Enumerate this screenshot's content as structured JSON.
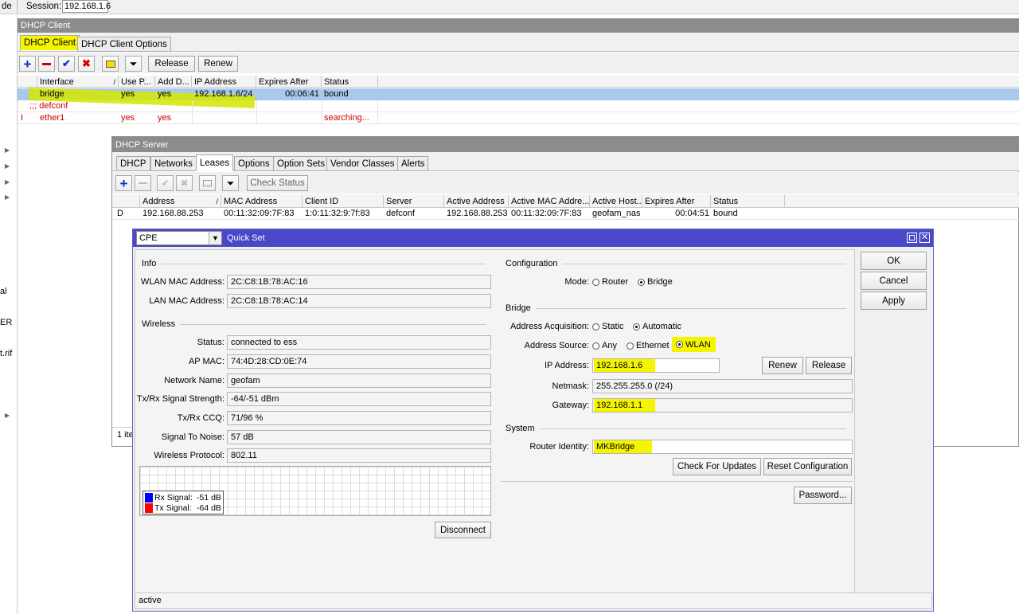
{
  "topbar": {
    "cut_left": "de",
    "session_label": "Session:",
    "session_value": "192.168.1.6"
  },
  "left_strip": {
    "labels": [
      "al",
      "ER",
      "t.rif"
    ]
  },
  "dhcp_client": {
    "title": "DHCP Client",
    "tabs": [
      "DHCP Client",
      "DHCP Client Options"
    ],
    "toolbar": {
      "release": "Release",
      "renew": "Renew"
    },
    "columns": [
      "Interface",
      "Use P...",
      "Add D...",
      "IP Address",
      "Expires After",
      "Status"
    ],
    "rows": [
      {
        "flag": "",
        "interface": "bridge",
        "use_peer": "yes",
        "add_default": "yes",
        "ip": "192.168.1.6/24",
        "expires": "00:06:41",
        "status": "bound"
      },
      {
        "flag": "",
        "interface": ";;; defconf",
        "use_peer": "",
        "add_default": "",
        "ip": "",
        "expires": "",
        "status": ""
      },
      {
        "flag": "I",
        "interface": "ether1",
        "use_peer": "yes",
        "add_default": "yes",
        "ip": "",
        "expires": "",
        "status": "searching..."
      }
    ]
  },
  "dhcp_server": {
    "title": "DHCP Server",
    "tabs": [
      "DHCP",
      "Networks",
      "Leases",
      "Options",
      "Option Sets",
      "Vendor Classes",
      "Alerts"
    ],
    "toolbar": {
      "check_status": "Check Status"
    },
    "columns": [
      "Address",
      "MAC Address",
      "Client ID",
      "Server",
      "Active Address",
      "Active MAC Addre...",
      "Active Host...",
      "Expires After",
      "Status"
    ],
    "rows": [
      {
        "flag": "D",
        "address": "192.168.88.253",
        "mac": "00:11:32:09:7F:83",
        "client_id": "1:0:11:32:9:7f:83",
        "server": "defconf",
        "active_address": "192.168.88.253",
        "active_mac": "00:11:32:09:7F:83",
        "active_host": "geofam_nas",
        "expires": "00:04:51",
        "status": "bound"
      }
    ],
    "footer": "1 ite"
  },
  "quick_set": {
    "mode_select": "CPE",
    "title": "Quick Set",
    "info": {
      "heading": "Info",
      "wlan_mac_label": "WLAN MAC Address:",
      "wlan_mac": "2C:C8:1B:78:AC:16",
      "lan_mac_label": "LAN MAC Address:",
      "lan_mac": "2C:C8:1B:78:AC:14"
    },
    "wireless": {
      "heading": "Wireless",
      "status_label": "Status:",
      "status": "connected to ess",
      "ap_mac_label": "AP MAC:",
      "ap_mac": "74:4D:28:CD:0E:74",
      "network_name_label": "Network Name:",
      "network_name": "geofam",
      "signal_label": "Tx/Rx Signal Strength:",
      "signal": "-64/-51 dBm",
      "ccq_label": "Tx/Rx CCQ:",
      "ccq": "71/96 %",
      "snr_label": "Signal To Noise:",
      "snr": "57 dB",
      "protocol_label": "Wireless Protocol:",
      "protocol": "802.11",
      "legend_rx_label": "Rx Signal:",
      "legend_rx": "-51 dB",
      "legend_tx_label": "Tx Signal:",
      "legend_tx": "-64 dB",
      "disconnect": "Disconnect"
    },
    "configuration": {
      "heading": "Configuration",
      "mode_label": "Mode:",
      "router": "Router",
      "bridge": "Bridge",
      "selected": "Bridge"
    },
    "bridge": {
      "heading": "Bridge",
      "acq_label": "Address Acquisition:",
      "static": "Static",
      "automatic": "Automatic",
      "source_label": "Address Source:",
      "any": "Any",
      "ethernet": "Ethernet",
      "wlan": "WLAN",
      "ip_label": "IP Address:",
      "ip": "192.168.1.6",
      "netmask_label": "Netmask:",
      "netmask": "255.255.255.0 (/24)",
      "gateway_label": "Gateway:",
      "gateway": "192.168.1.1",
      "renew": "Renew",
      "release": "Release"
    },
    "system": {
      "heading": "System",
      "identity_label": "Router Identity:",
      "identity": "MKBridge",
      "check_updates": "Check For Updates",
      "reset": "Reset Configuration",
      "password": "Password..."
    },
    "buttons": {
      "ok": "OK",
      "cancel": "Cancel",
      "apply": "Apply"
    },
    "status": "active"
  },
  "colors": {
    "rx": "#0000ff",
    "tx": "#ff0000",
    "highlight": "#f5f500",
    "selected_row": "#a8c8ec",
    "title_blue": "#4848c8"
  }
}
